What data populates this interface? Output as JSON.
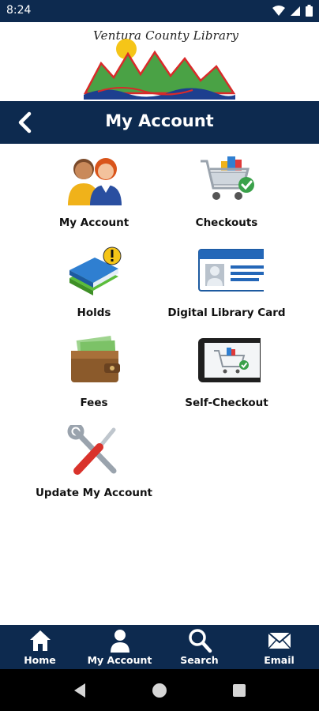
{
  "status_bar": {
    "time": "8:24"
  },
  "logo": {
    "text": "Ventura County Library"
  },
  "header": {
    "title": "My Account",
    "back_icon": "chevron-left-icon"
  },
  "tiles": [
    {
      "label": "My Account",
      "icon": "people-icon"
    },
    {
      "label": "Checkouts",
      "icon": "cart-icon"
    },
    {
      "label": "Holds",
      "icon": "books-hold-icon"
    },
    {
      "label": "Digital Library Card",
      "icon": "id-card-icon"
    },
    {
      "label": "Fees",
      "icon": "wallet-icon"
    },
    {
      "label": "Self-Checkout",
      "icon": "phone-cart-icon"
    },
    {
      "label": "Update My Account",
      "icon": "tools-icon"
    }
  ],
  "bottom_nav": [
    {
      "label": "Home",
      "icon": "home-icon"
    },
    {
      "label": "My Account",
      "icon": "person-icon"
    },
    {
      "label": "Search",
      "icon": "search-icon"
    },
    {
      "label": "Email",
      "icon": "envelope-icon"
    }
  ],
  "colors": {
    "navy": "#0d2a4f",
    "accent_green": "#3aa14a",
    "accent_red": "#d9322b"
  }
}
